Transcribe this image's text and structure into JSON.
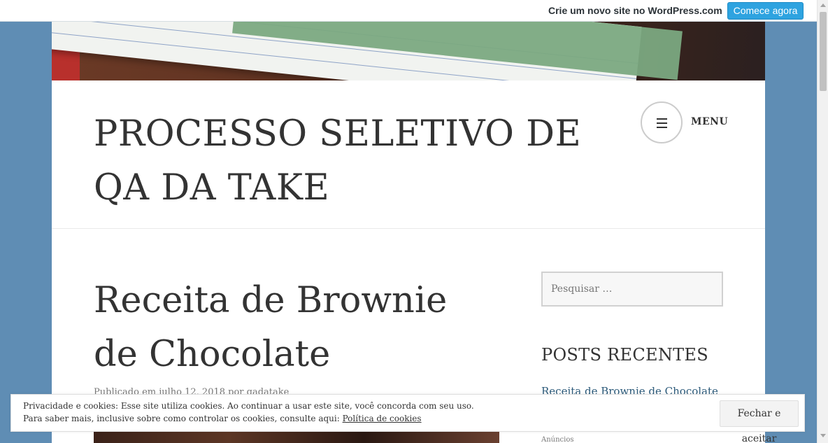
{
  "wpbar": {
    "create_label": "Crie um novo site no WordPress.com",
    "cta_label": "Comece agora"
  },
  "site": {
    "title": "PROCESSO SELETIVO DE QA DA TAKE",
    "menu_label": "MENU"
  },
  "post": {
    "title": "Receita de Brownie de Chocolate",
    "meta": "Publicado em julho 12, 2018 por qadatake"
  },
  "sidebar": {
    "search_placeholder": "Pesquisar …",
    "recent_title": "POSTS RECENTES",
    "recent_posts": [
      "Receita de Brownie de Chocolate"
    ],
    "ads_label": "Anúncios"
  },
  "cookie": {
    "line1": "Privacidade e cookies: Esse site utiliza cookies. Ao continuar a usar este site, você concorda com seu uso.",
    "line2_prefix": "Para saber mais, inclusive sobre como controlar os cookies, consulte aqui: ",
    "link": "Política de cookies",
    "accept_label": "Fechar e aceitar"
  },
  "colors": {
    "background": "#5f8db4",
    "cta": "#2ea3e0",
    "link": "#2c5a7a"
  }
}
